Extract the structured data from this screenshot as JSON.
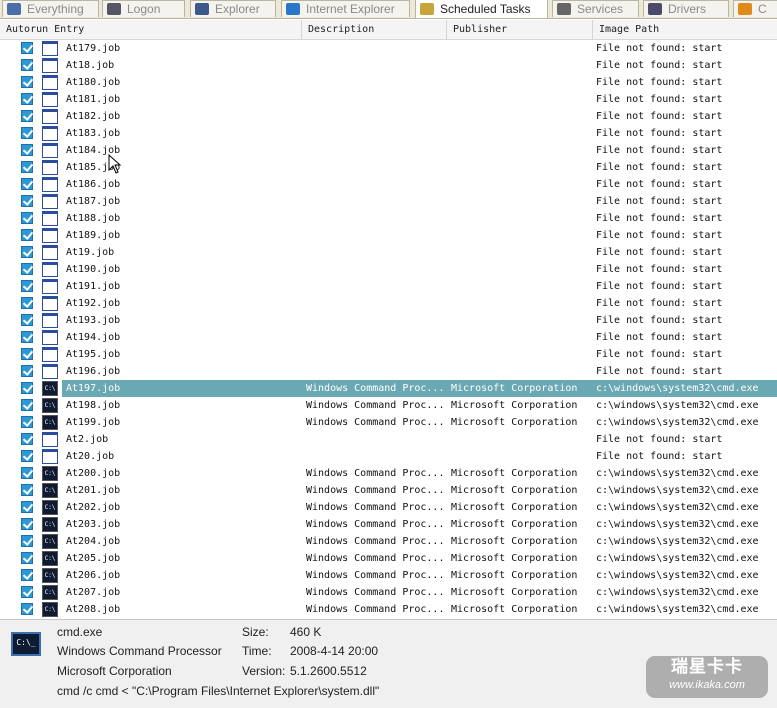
{
  "tabs": [
    {
      "label": "Everything",
      "icon": "everything-icon",
      "active": false
    },
    {
      "label": "Logon",
      "icon": "logon-icon",
      "active": false
    },
    {
      "label": "Explorer",
      "icon": "explorer-icon",
      "active": false
    },
    {
      "label": "Internet Explorer",
      "icon": "internet-explorer-icon",
      "active": false
    },
    {
      "label": "Scheduled Tasks",
      "icon": "scheduled-tasks-icon",
      "active": true
    },
    {
      "label": "Services",
      "icon": "services-icon",
      "active": false
    },
    {
      "label": "Drivers",
      "icon": "drivers-icon",
      "active": false
    },
    {
      "label": "C",
      "icon": "codecs-icon",
      "active": false
    }
  ],
  "columns": {
    "entry": "Autorun Entry",
    "description": "Description",
    "publisher": "Publisher",
    "path": "Image Path"
  },
  "rows": [
    {
      "name": "At179.job",
      "icon": "doc",
      "desc": "",
      "pub": "",
      "path": "File not found: start",
      "sel": false
    },
    {
      "name": "At18.job",
      "icon": "doc",
      "desc": "",
      "pub": "",
      "path": "File not found: start",
      "sel": false
    },
    {
      "name": "At180.job",
      "icon": "doc",
      "desc": "",
      "pub": "",
      "path": "File not found: start",
      "sel": false
    },
    {
      "name": "At181.job",
      "icon": "doc",
      "desc": "",
      "pub": "",
      "path": "File not found: start",
      "sel": false
    },
    {
      "name": "At182.job",
      "icon": "doc",
      "desc": "",
      "pub": "",
      "path": "File not found: start",
      "sel": false
    },
    {
      "name": "At183.job",
      "icon": "doc",
      "desc": "",
      "pub": "",
      "path": "File not found: start",
      "sel": false
    },
    {
      "name": "At184.job",
      "icon": "doc",
      "desc": "",
      "pub": "",
      "path": "File not found: start",
      "sel": false
    },
    {
      "name": "At185.job",
      "icon": "doc",
      "desc": "",
      "pub": "",
      "path": "File not found: start",
      "sel": false
    },
    {
      "name": "At186.job",
      "icon": "doc",
      "desc": "",
      "pub": "",
      "path": "File not found: start",
      "sel": false
    },
    {
      "name": "At187.job",
      "icon": "doc",
      "desc": "",
      "pub": "",
      "path": "File not found: start",
      "sel": false
    },
    {
      "name": "At188.job",
      "icon": "doc",
      "desc": "",
      "pub": "",
      "path": "File not found: start",
      "sel": false
    },
    {
      "name": "At189.job",
      "icon": "doc",
      "desc": "",
      "pub": "",
      "path": "File not found: start",
      "sel": false
    },
    {
      "name": "At19.job",
      "icon": "doc",
      "desc": "",
      "pub": "",
      "path": "File not found: start",
      "sel": false
    },
    {
      "name": "At190.job",
      "icon": "doc",
      "desc": "",
      "pub": "",
      "path": "File not found: start",
      "sel": false
    },
    {
      "name": "At191.job",
      "icon": "doc",
      "desc": "",
      "pub": "",
      "path": "File not found: start",
      "sel": false
    },
    {
      "name": "At192.job",
      "icon": "doc",
      "desc": "",
      "pub": "",
      "path": "File not found: start",
      "sel": false
    },
    {
      "name": "At193.job",
      "icon": "doc",
      "desc": "",
      "pub": "",
      "path": "File not found: start",
      "sel": false
    },
    {
      "name": "At194.job",
      "icon": "doc",
      "desc": "",
      "pub": "",
      "path": "File not found: start",
      "sel": false
    },
    {
      "name": "At195.job",
      "icon": "doc",
      "desc": "",
      "pub": "",
      "path": "File not found: start",
      "sel": false
    },
    {
      "name": "At196.job",
      "icon": "doc",
      "desc": "",
      "pub": "",
      "path": "File not found: start",
      "sel": false
    },
    {
      "name": "At197.job",
      "icon": "cmd",
      "desc": "Windows Command Proc...",
      "pub": "Microsoft Corporation",
      "path": "c:\\windows\\system32\\cmd.exe",
      "sel": true
    },
    {
      "name": "At198.job",
      "icon": "cmd",
      "desc": "Windows Command Proc...",
      "pub": "Microsoft Corporation",
      "path": "c:\\windows\\system32\\cmd.exe",
      "sel": false
    },
    {
      "name": "At199.job",
      "icon": "cmd",
      "desc": "Windows Command Proc...",
      "pub": "Microsoft Corporation",
      "path": "c:\\windows\\system32\\cmd.exe",
      "sel": false
    },
    {
      "name": "At2.job",
      "icon": "doc",
      "desc": "",
      "pub": "",
      "path": "File not found: start",
      "sel": false
    },
    {
      "name": "At20.job",
      "icon": "doc",
      "desc": "",
      "pub": "",
      "path": "File not found: start",
      "sel": false
    },
    {
      "name": "At200.job",
      "icon": "cmd",
      "desc": "Windows Command Proc...",
      "pub": "Microsoft Corporation",
      "path": "c:\\windows\\system32\\cmd.exe",
      "sel": false
    },
    {
      "name": "At201.job",
      "icon": "cmd",
      "desc": "Windows Command Proc...",
      "pub": "Microsoft Corporation",
      "path": "c:\\windows\\system32\\cmd.exe",
      "sel": false
    },
    {
      "name": "At202.job",
      "icon": "cmd",
      "desc": "Windows Command Proc...",
      "pub": "Microsoft Corporation",
      "path": "c:\\windows\\system32\\cmd.exe",
      "sel": false
    },
    {
      "name": "At203.job",
      "icon": "cmd",
      "desc": "Windows Command Proc...",
      "pub": "Microsoft Corporation",
      "path": "c:\\windows\\system32\\cmd.exe",
      "sel": false
    },
    {
      "name": "At204.job",
      "icon": "cmd",
      "desc": "Windows Command Proc...",
      "pub": "Microsoft Corporation",
      "path": "c:\\windows\\system32\\cmd.exe",
      "sel": false
    },
    {
      "name": "At205.job",
      "icon": "cmd",
      "desc": "Windows Command Proc...",
      "pub": "Microsoft Corporation",
      "path": "c:\\windows\\system32\\cmd.exe",
      "sel": false
    },
    {
      "name": "At206.job",
      "icon": "cmd",
      "desc": "Windows Command Proc...",
      "pub": "Microsoft Corporation",
      "path": "c:\\windows\\system32\\cmd.exe",
      "sel": false
    },
    {
      "name": "At207.job",
      "icon": "cmd",
      "desc": "Windows Command Proc...",
      "pub": "Microsoft Corporation",
      "path": "c:\\windows\\system32\\cmd.exe",
      "sel": false
    },
    {
      "name": "At208.job",
      "icon": "cmd",
      "desc": "Windows Command Proc...",
      "pub": "Microsoft Corporation",
      "path": "c:\\windows\\system32\\cmd.exe",
      "sel": false
    }
  ],
  "details": {
    "icon": "cmd-icon",
    "icon_text": "C:\\_",
    "name": "cmd.exe",
    "description": "Windows Command Processor",
    "company": "Microsoft Corporation",
    "command_line": "cmd /c cmd < \"C:\\Program Files\\Internet Explorer\\system.dll\"",
    "size_label": "Size:",
    "size_value": "460 K",
    "time_label": "Time:",
    "time_value": "2008-4-14 20:00",
    "version_label": "Version:",
    "version_value": "5.1.2600.5512"
  },
  "watermark": {
    "line1": "瑞星卡卡",
    "line2": "www.ikaka.com"
  },
  "colors": {
    "selection": "#6aa9b3",
    "checkbox": "#2d98d6",
    "tab_bar": "#ece9d8"
  }
}
